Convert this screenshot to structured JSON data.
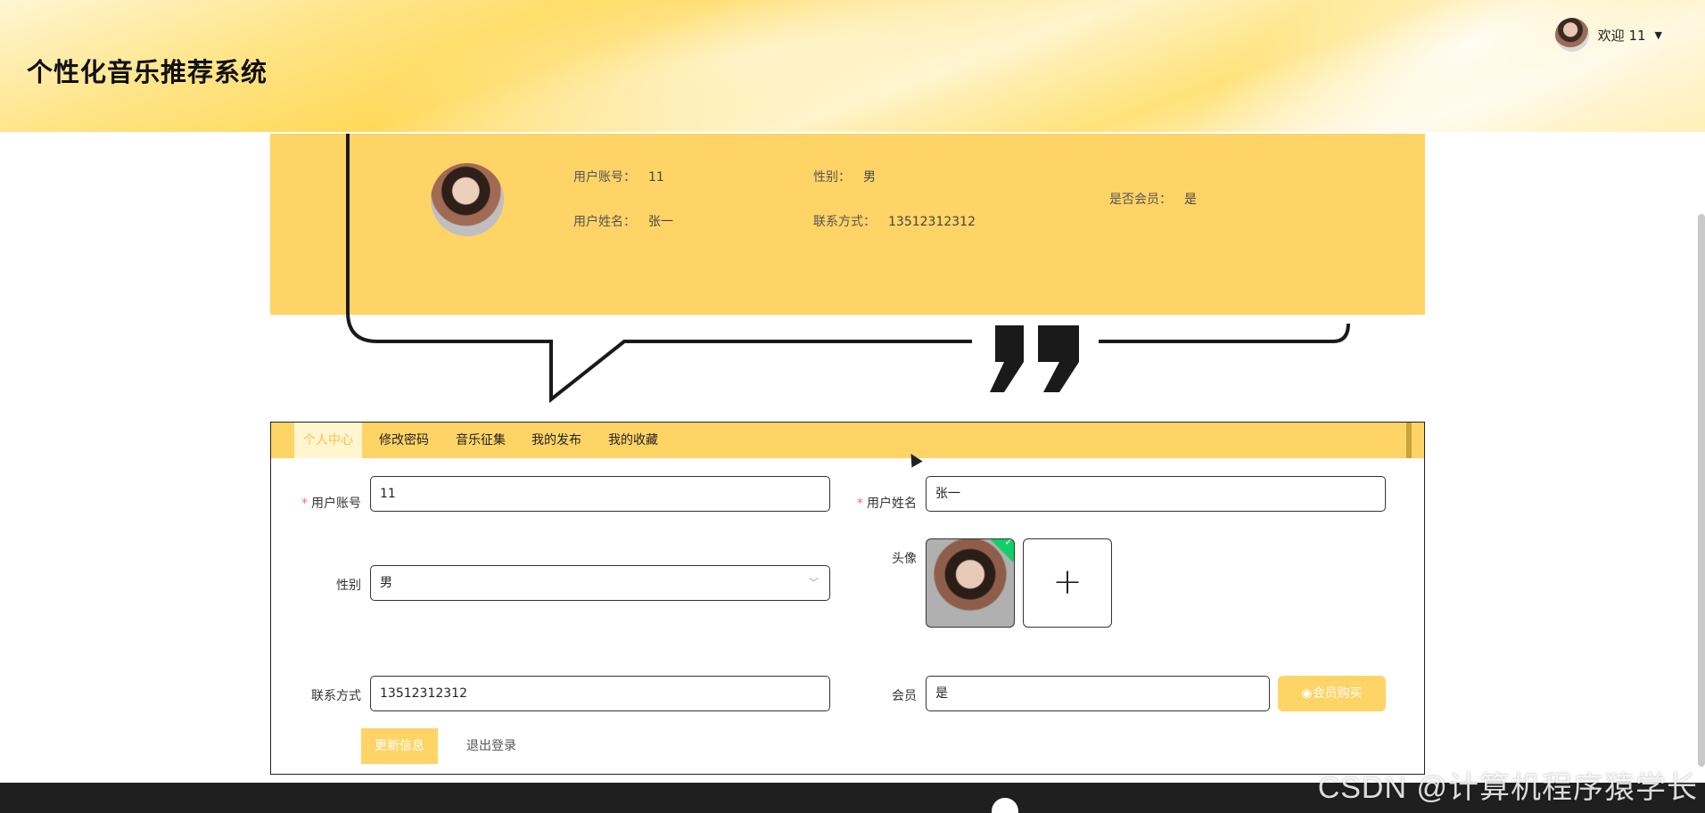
{
  "header": {
    "site_title": "个性化音乐推荐系统",
    "welcome_text": "欢迎 11"
  },
  "profile": {
    "account_label": "用户账号：",
    "account_value": "11",
    "name_label": "用户姓名：",
    "name_value": "张一",
    "gender_label": "性别：",
    "gender_value": "男",
    "contact_label": "联系方式：",
    "contact_value": "13512312312",
    "vip_label": "是否会员：",
    "vip_value": "是"
  },
  "tabs": [
    {
      "label": "个人中心",
      "active": true
    },
    {
      "label": "修改密码",
      "active": false
    },
    {
      "label": "音乐征集",
      "active": false
    },
    {
      "label": "我的发布",
      "active": false
    },
    {
      "label": "我的收藏",
      "active": false
    }
  ],
  "form": {
    "account_label": "用户账号",
    "account_value": "11",
    "name_label": "用户姓名",
    "name_value": "张一",
    "gender_label": "性别",
    "gender_value": "男",
    "avatar_label": "头像",
    "contact_label": "联系方式",
    "contact_value": "13512312312",
    "vip_label": "会员",
    "vip_value": "是",
    "vip_button": "会员购买",
    "update_button": "更新信息",
    "logout_button": "退出登录"
  },
  "watermark": "CSDN @计算机程序猿学长",
  "colors": {
    "accent": "#ffd466",
    "required": "#f56c6c",
    "success": "#13ce66"
  },
  "icons": [
    "user-avatar",
    "caret-down-icon",
    "chevron-down-icon",
    "check-icon",
    "plus-icon",
    "vip-icon",
    "quote-icon"
  ]
}
